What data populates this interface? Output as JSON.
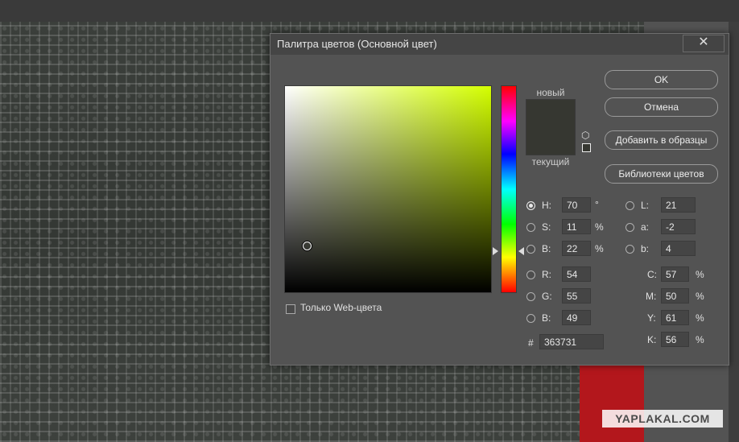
{
  "dialog": {
    "title": "Палитра цветов (Основной цвет)",
    "close_glyph": "✕"
  },
  "preview": {
    "new_label": "новый",
    "current_label": "текущий",
    "color": "#363731"
  },
  "buttons": {
    "ok": "OK",
    "cancel": "Отмена",
    "add_swatches": "Добавить в образцы",
    "libraries": "Библиотеки цветов"
  },
  "web_only_label": "Только Web-цвета",
  "hsb": {
    "h_label": "H:",
    "h_value": "70",
    "h_unit": "°",
    "s_label": "S:",
    "s_value": "11",
    "s_unit": "%",
    "b_label": "B:",
    "b_value": "22",
    "b_unit": "%"
  },
  "rgb": {
    "r_label": "R:",
    "r_value": "54",
    "g_label": "G:",
    "g_value": "55",
    "b_label": "B:",
    "b_value": "49"
  },
  "lab": {
    "l_label": "L:",
    "l_value": "21",
    "a_label": "a:",
    "a_value": "-2",
    "b_label": "b:",
    "b_value": "4"
  },
  "cmyk": {
    "c_label": "C:",
    "c_value": "57",
    "c_unit": "%",
    "m_label": "M:",
    "m_value": "50",
    "m_unit": "%",
    "y_label": "Y:",
    "y_value": "61",
    "y_unit": "%",
    "k_label": "K:",
    "k_value": "56",
    "k_unit": "%"
  },
  "hex": {
    "label": "#",
    "value": "363731"
  },
  "watermark": "YAPLAKAL.COM"
}
